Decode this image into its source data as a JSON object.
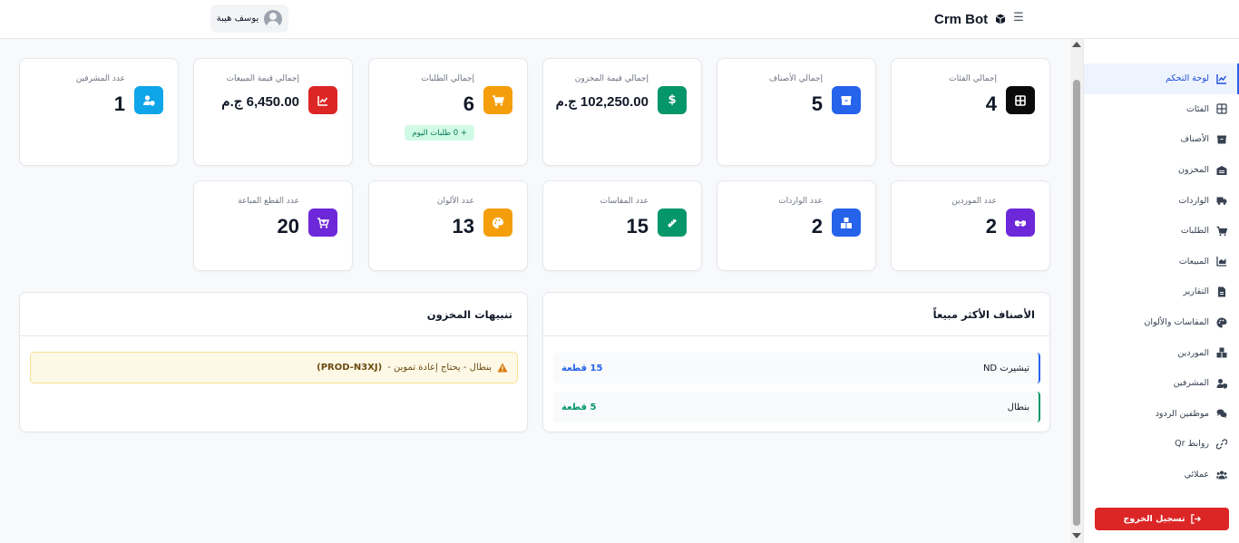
{
  "topbar": {
    "menu_icon": "bars-icon",
    "brand": "Crm Bot",
    "brand_icon": "cube-icon",
    "user_name": "يوسف هيبة",
    "user_icon": "user-circle-icon"
  },
  "sidebar": {
    "items": [
      {
        "label": "لوحة التحكم",
        "icon": "chart-line-icon",
        "active": true
      },
      {
        "label": "الفئات",
        "icon": "grid-icon",
        "active": false
      },
      {
        "label": "الأصناف",
        "icon": "box-icon",
        "active": false
      },
      {
        "label": "المخزون",
        "icon": "warehouse-icon",
        "active": false
      },
      {
        "label": "الواردات",
        "icon": "truck-icon",
        "active": false
      },
      {
        "label": "الطلبات",
        "icon": "cart-icon",
        "active": false
      },
      {
        "label": "المبيعات",
        "icon": "chart-area-icon",
        "active": false
      },
      {
        "label": "التقارير",
        "icon": "file-icon",
        "active": false
      },
      {
        "label": "المقاسات والألوان",
        "icon": "palette-icon",
        "active": false
      },
      {
        "label": "الموردين",
        "icon": "boxes-icon",
        "active": false
      },
      {
        "label": "المشرفين",
        "icon": "user-shield-icon",
        "active": false
      },
      {
        "label": "موظفين الردود",
        "icon": "comments-icon",
        "active": false
      },
      {
        "label": "روابط Qr",
        "icon": "link-icon",
        "active": false
      },
      {
        "label": "عملائي",
        "icon": "users-icon",
        "active": false
      }
    ],
    "logout_label": "تسجيل الخروج",
    "logout_icon": "sign-out-icon"
  },
  "stats_row1": [
    {
      "label": "إجمالي الفئات",
      "value": "4",
      "icon": "grid-icon",
      "color": "#0b0b0b"
    },
    {
      "label": "إجمالي الأصناف",
      "value": "5",
      "icon": "box-icon",
      "color": "#2563eb"
    },
    {
      "label": "إجمالي قيمة المخزون",
      "value": "102,250.00 ج.م",
      "icon": "dollar-icon",
      "color": "#059669"
    },
    {
      "label": "إجمالي الطلبات",
      "value": "6",
      "icon": "cart-icon",
      "color": "#f59e0b",
      "badge": "+ 0 طلبات اليوم"
    },
    {
      "label": "إجمالي قيمة المبيعات",
      "value": "6,450.00 ج.م",
      "icon": "chart-line-icon",
      "color": "#dc2626"
    },
    {
      "label": "عدد المشرفين",
      "value": "1",
      "icon": "user-shield-icon",
      "color": "#0ea5e9"
    }
  ],
  "stats_row2": [
    {
      "label": "عدد الموردين",
      "value": "2",
      "icon": "handshake-icon",
      "color": "#6d28d9"
    },
    {
      "label": "عدد الواردات",
      "value": "2",
      "icon": "boxes-icon",
      "color": "#2563eb"
    },
    {
      "label": "عدد المقاسات",
      "value": "15",
      "icon": "ruler-icon",
      "color": "#059669"
    },
    {
      "label": "عدد الألوان",
      "value": "13",
      "icon": "palette-icon",
      "color": "#f59e0b"
    },
    {
      "label": "عدد القطع المباعة",
      "value": "20",
      "icon": "cart-plus-icon",
      "color": "#6d28d9"
    }
  ],
  "best_sellers": {
    "title": "الأصناف الأكثر مبيعاً",
    "rows": [
      {
        "name": "تيشيرت ND",
        "qty": "15 قطعة",
        "color": "#2563eb"
      },
      {
        "name": "بنطال",
        "qty": "5 قطعة",
        "color": "#059669"
      }
    ]
  },
  "stock_alerts": {
    "title": "تنبيهات المخزون",
    "alert_icon": "warning-icon",
    "alert_text": "بنطال - يحتاج إعادة تموين - ",
    "alert_sku": "(PROD-N3XJ)"
  }
}
